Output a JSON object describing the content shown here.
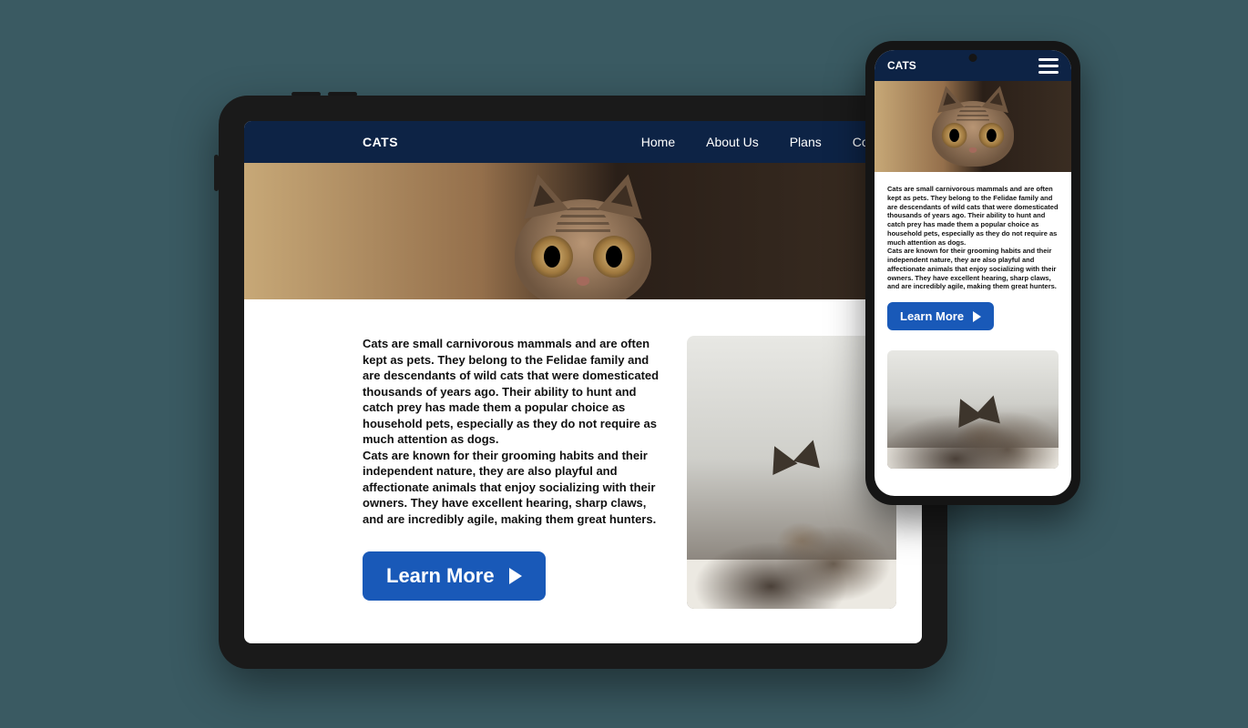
{
  "brand": "CATS",
  "nav": {
    "items": [
      "Home",
      "About Us",
      "Plans",
      "Contact"
    ]
  },
  "body": {
    "paragraph1": "Cats are small carnivorous mammals and are often kept as pets. They belong to the Felidae family and are descendants of wild cats that were domesticated thousands of years ago. Their ability to hunt and catch prey has made them a popular choice as household pets, especially as they do not require as much attention as dogs.",
    "paragraph2": "Cats are known for their grooming habits and their independent nature, they are also playful and affectionate animals that enjoy socializing with their owners. They have excellent hearing, sharp claws, and are incredibly agile, making them great hunters."
  },
  "cta": {
    "label": "Learn More"
  }
}
